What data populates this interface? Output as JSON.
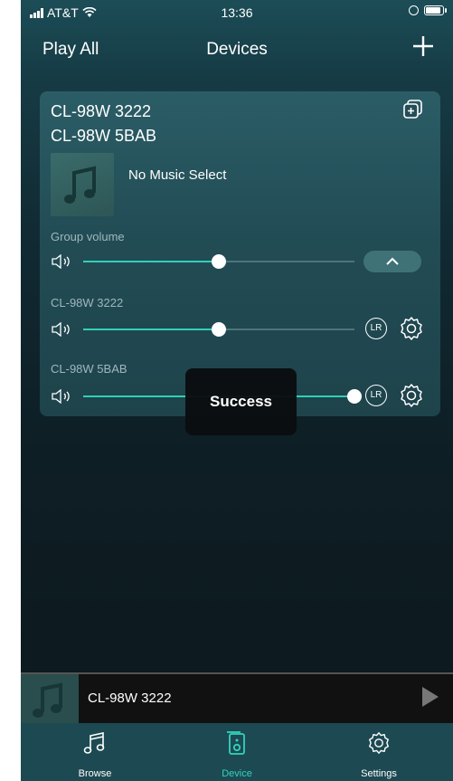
{
  "status_bar": {
    "carrier": "AT&T",
    "time": "13:36"
  },
  "nav": {
    "left_label": "Play All",
    "title": "Devices",
    "add_icon": "plus-icon"
  },
  "card": {
    "device_names": [
      "CL-98W 3222",
      "CL-98W 5BAB"
    ],
    "now_playing": "No Music Select",
    "group_volume": {
      "label": "Group volume",
      "level": 0.5
    },
    "devices": [
      {
        "name": "CL-98W 3222",
        "volume": 0.5,
        "channel": "LR"
      },
      {
        "name": "CL-98W 5BAB",
        "volume": 1.0,
        "channel": "LR"
      }
    ]
  },
  "toast": "Success",
  "mini_player": {
    "device": "CL-98W 3222",
    "play_icon": "play-icon"
  },
  "tabs": [
    {
      "label": "Browse",
      "icon": "music-note-icon",
      "active": false
    },
    {
      "label": "Device",
      "icon": "speaker-icon",
      "active": true
    },
    {
      "label": "Settings",
      "icon": "gear-icon",
      "active": false
    }
  ],
  "colors": {
    "accent": "#2fd1b7",
    "card": "#224c55",
    "tabbar": "#1d4a52"
  }
}
